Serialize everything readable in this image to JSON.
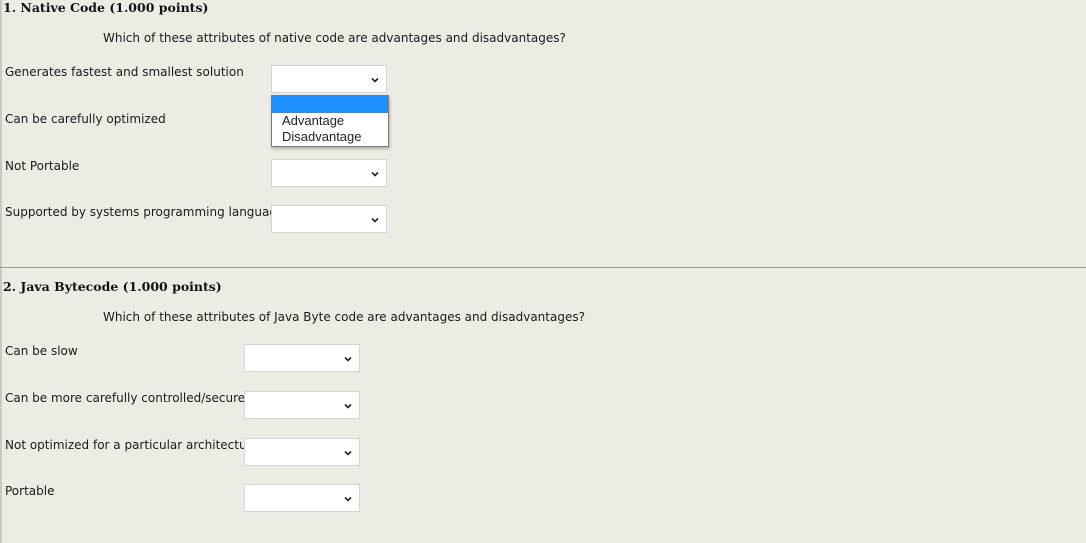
{
  "questions": [
    {
      "title": "1. Native Code (1.000 points)",
      "prompt": "Which of these attributes of native code are advantages and disadvantages?",
      "items": [
        {
          "label": "Generates fastest and smallest solution",
          "value": ""
        },
        {
          "label": "Can be carefully optimized",
          "value": ""
        },
        {
          "label": "Not Portable",
          "value": ""
        },
        {
          "label": "Supported by systems programming languages",
          "value": ""
        }
      ]
    },
    {
      "title": "2. Java Bytecode (1.000 points)",
      "prompt": "Which of these attributes of Java Byte code are advantages and disadvantages?",
      "items": [
        {
          "label": "Can be slow",
          "value": ""
        },
        {
          "label": "Can be more carefully controlled/secure",
          "value": ""
        },
        {
          "label": "Not optimized for a particular architecture",
          "value": ""
        },
        {
          "label": "Portable",
          "value": ""
        }
      ]
    }
  ],
  "open_dropdown": {
    "options": [
      "",
      "Advantage",
      "Disadvantage"
    ],
    "highlighted_index": 0
  },
  "colors": {
    "background": "#ecece4",
    "highlight": "#1e90ff"
  },
  "icons": {
    "select_arrow": "chevron-down-icon"
  }
}
